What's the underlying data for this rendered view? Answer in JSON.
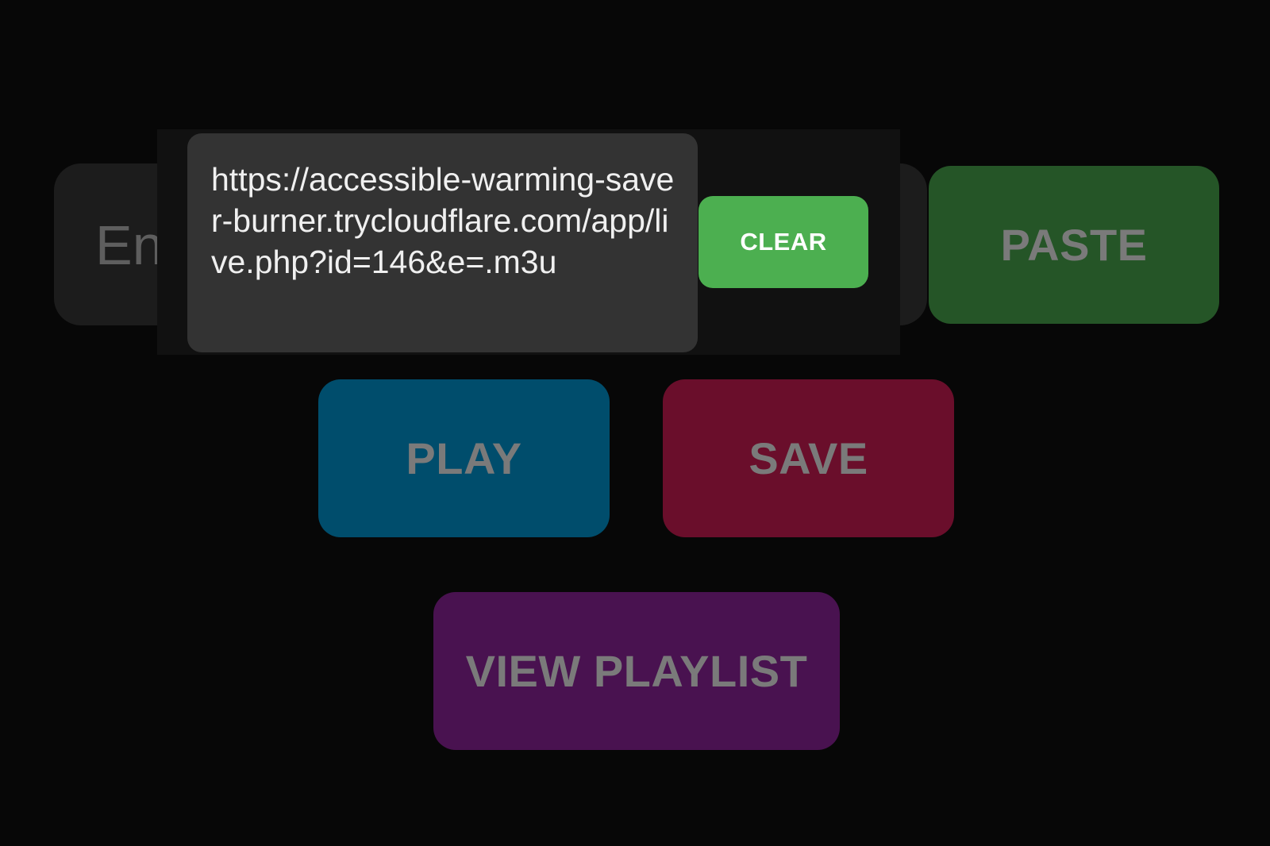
{
  "url_input": {
    "hint_visible": "En"
  },
  "buttons": {
    "paste": "PASTE",
    "play": "PLAY",
    "save": "SAVE",
    "view_playlist": "VIEW PLAYLIST"
  },
  "popup": {
    "url_text": "https://accessible-warming-saver-burner.trycloudflare.com/app/live.php?id=146&e=.m3u",
    "clear_label": "CLEAR"
  },
  "colors": {
    "paste": "#255527",
    "play": "#004d6c",
    "save": "#6a0e2b",
    "view_playlist": "#491250",
    "clear": "#4caf50"
  }
}
